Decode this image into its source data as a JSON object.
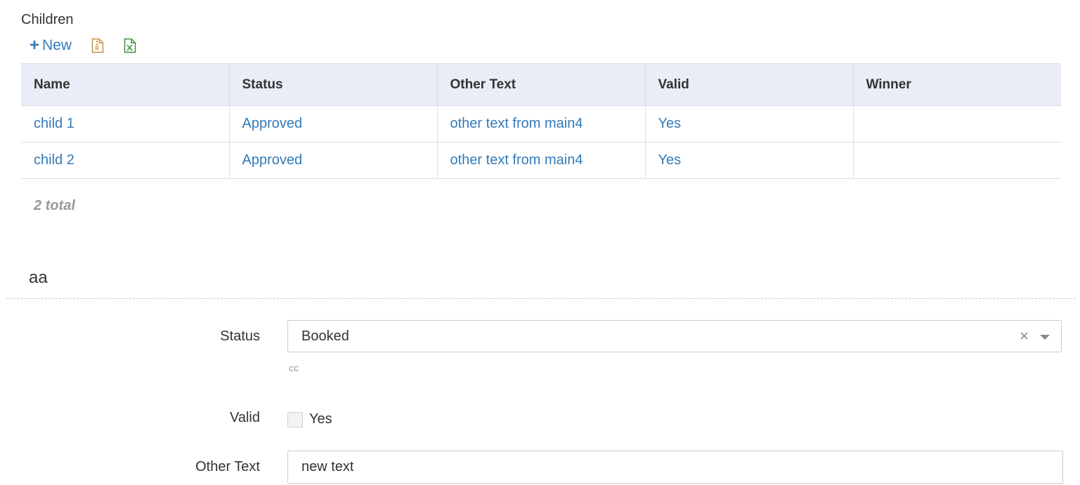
{
  "section": {
    "title": "Children",
    "new_label": "New"
  },
  "icons": {
    "plus": "plus-icon",
    "zip": "zip-file-icon",
    "excel": "excel-file-icon",
    "clear": "clear-icon",
    "dropdown": "chevron-down-icon"
  },
  "colors": {
    "link": "#337ab7",
    "header_bg": "#e8edf7",
    "zip_icon": "#c8914a",
    "excel_icon": "#3f8f3f"
  },
  "table": {
    "columns": [
      "Name",
      "Status",
      "Other Text",
      "Valid",
      "Winner"
    ],
    "rows": [
      [
        "child 1",
        "Approved",
        "other text from main4",
        "Yes",
        ""
      ],
      [
        "child 2",
        "Approved",
        "other text from main4",
        "Yes",
        ""
      ]
    ],
    "total": "2 total"
  },
  "group": {
    "title": "aa"
  },
  "form": {
    "status": {
      "label": "Status",
      "value": "Booked",
      "help": "cc"
    },
    "valid": {
      "label": "Valid",
      "checkbox_label": "Yes",
      "checked": false
    },
    "other_text": {
      "label": "Other Text",
      "value": "new text"
    }
  }
}
